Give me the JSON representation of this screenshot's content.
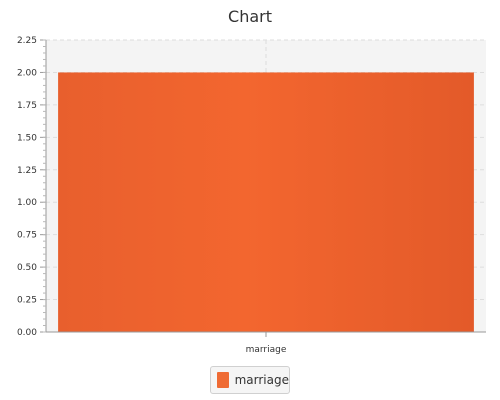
{
  "chart_data": {
    "type": "bar",
    "title": "Chart",
    "categories": [
      "marriage"
    ],
    "series": [
      {
        "name": "marriage",
        "values": [
          2.0
        ]
      }
    ],
    "xlabel": "",
    "ylabel": "",
    "ylim": [
      0,
      2.25
    ],
    "yticks": [
      "0.00",
      "0.25",
      "0.50",
      "0.75",
      "1.00",
      "1.25",
      "1.50",
      "1.75",
      "2.00",
      "2.25"
    ],
    "grid": true,
    "legend_position": "bottom-center",
    "colors": {
      "bar": "#ef6b34",
      "plot_background": "#f4f4f4",
      "gridline": "#dddddd"
    }
  }
}
